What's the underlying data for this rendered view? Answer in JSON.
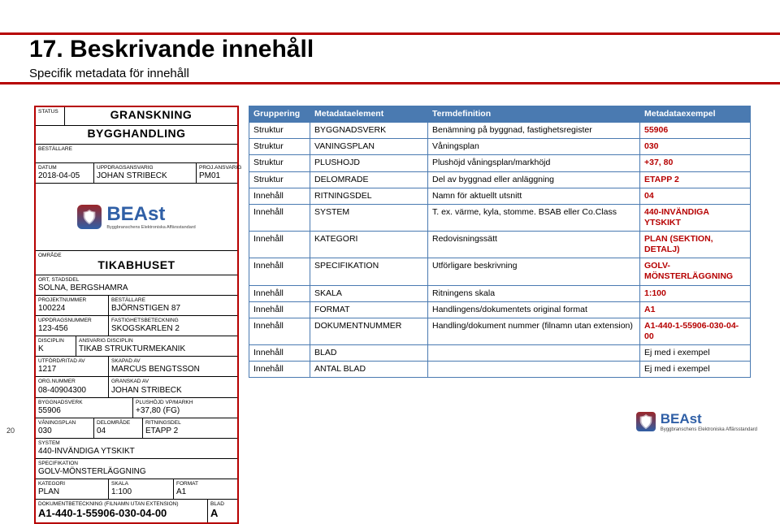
{
  "title": "17. Beskrivande innehåll",
  "subtitle": "Specifik metadata för innehåll",
  "pagenum": "20",
  "logo": {
    "brand": "BEAst",
    "tagline": "Byggbranschens Elektroniska Affärsstandard"
  },
  "form": {
    "r1": {
      "status_lbl": "STATUS",
      "status_val": "",
      "gransk": "GRANSKNING",
      "bygghand": "BYGGHANDLING"
    },
    "r2": {
      "best_lbl": "BESTÄLLARE",
      "best_val": ""
    },
    "r3": {
      "datum_lbl": "DATUM",
      "datum_val": "2018-04-05",
      "upp_lbl": "UPPDRAGSANSVARIG",
      "upp_val": "JOHAN STRIBECK",
      "proj_lbl": "PROJ.ANSVARIG",
      "proj_val": "PM01"
    },
    "r4": {
      "omr_lbl": "OMRÅDE",
      "omr_val": "TIKABHUSET"
    },
    "r5": {
      "ort_lbl": "ORT, STADSDEL",
      "ort_val": "SOLNA, BERGSHAMRA"
    },
    "r6": {
      "proj_lbl": "PROJEKTNUMMER",
      "proj_val": "100224",
      "best_lbl": "BESTÄLLARE",
      "best_val": "BJÖRNSTIGEN 87"
    },
    "r7": {
      "uppd_lbl": "UPPDRAGSNUMMER",
      "uppd_val": "123-456",
      "fast_lbl": "FASTIGHETSBETECKNING",
      "fast_val": "SKOGSKARLEN 2"
    },
    "r8": {
      "disc_lbl": "DISCIPLIN",
      "disc_val": "K",
      "ans_lbl": "ANSVARIG DISCIPLIN",
      "ans_val": "TIKAB STRUKTURMEKANIK"
    },
    "r9": {
      "uf_lbl": "UTFÖRD/RITAD AV",
      "uf_val": "1217",
      "skap_lbl": "SKAPAD AV",
      "skap_val": "MARCUS BENGTSSON"
    },
    "r10": {
      "orgn_lbl": "ORG.NUMMER",
      "orgn_val": "08-40904300",
      "gr_lbl": "GRANSKAD AV",
      "gr_val": "JOHAN STRIBECK"
    },
    "r11": {
      "bv_lbl": "BYGGNADSVERK",
      "bv_val": "55906",
      "plus_lbl": "PLUSHÖJD VP/MARKH",
      "plus_val": "+37,80 (FG)"
    },
    "r12": {
      "vp_lbl": "VÅNINGSPLAN",
      "vp_val": "030",
      "do_lbl": "DELOMRÅDE",
      "do_val": "04",
      "rit_lbl": "RITNINGSDEL",
      "rit_val": "ETAPP 2"
    },
    "r13": {
      "sys_lbl": "SYSTEM",
      "sys_val": "440-INVÄNDIGA YTSKIKT"
    },
    "r14": {
      "spec_lbl": "SPECIFIKATION",
      "spec_val": "GOLV-MÖNSTERLÄGGNING"
    },
    "r15": {
      "kat_lbl": "KATEGORI",
      "kat_val": "PLAN",
      "sk_lbl": "SKALA",
      "sk_val": "1:100",
      "fmt_lbl": "FORMAT",
      "fmt_val": "A1"
    },
    "r16": {
      "dok_lbl": "DOKUMENTBETECKNING (FILNAMN UTAN EXTENSION)",
      "dok_val": "A1-440-1-55906-030-04-00",
      "blad_lbl": "BLAD",
      "blad_val": "A"
    }
  },
  "table": {
    "headers": {
      "c1": "Gruppering",
      "c2": "Metadataelement",
      "c3": "Termdefinition",
      "c4": "Metadataexempel"
    },
    "rows": [
      {
        "c1": "Struktur",
        "c2": "BYGGNADSVERK",
        "c3": "Benämning på byggnad, fastighetsregister",
        "c4": "55906"
      },
      {
        "c1": "Struktur",
        "c2": "VANINGSPLAN",
        "c3": "Våningsplan",
        "c4": "030"
      },
      {
        "c1": "Struktur",
        "c2": "PLUSHOJD",
        "c3": "Plushöjd våningsplan/markhöjd",
        "c4": "+37, 80"
      },
      {
        "c1": "Struktur",
        "c2": "DELOMRADE",
        "c3": "Del av byggnad eller anläggning",
        "c4": "ETAPP 2"
      },
      {
        "c1": "Innehåll",
        "c2": "RITNINGSDEL",
        "c3": "Namn för aktuellt utsnitt",
        "c4": "04"
      },
      {
        "c1": "Innehåll",
        "c2": "SYSTEM",
        "c3": "T. ex. värme, kyla, stomme. BSAB eller Co.Class",
        "c4": "440-INVÄNDIGA YTSKIKT"
      },
      {
        "c1": "Innehåll",
        "c2": "KATEGORI",
        "c3": "Redovisningssätt",
        "c4": "PLAN (SEKTION, DETALJ)"
      },
      {
        "c1": "Innehåll",
        "c2": "SPECIFIKATION",
        "c3": "Utförligare beskrivning",
        "c4": "GOLV-MÖNSTERLÄGGNING"
      },
      {
        "c1": "Innehåll",
        "c2": "SKALA",
        "c3": "Ritningens skala",
        "c4": "1:100"
      },
      {
        "c1": "Innehåll",
        "c2": "FORMAT",
        "c3": "Handlingens/dokumentets original format",
        "c4": "A1"
      },
      {
        "c1": "Innehåll",
        "c2": "DOKUMENTNUMMER",
        "c3": "Handling/dokument nummer (filnamn utan extension)",
        "c4": "A1-440-1-55906-030-04-00"
      },
      {
        "c1": "Innehåll",
        "c2": "BLAD",
        "c3": "",
        "c4e": "Ej med i exempel"
      },
      {
        "c1": "Innehåll",
        "c2": "ANTAL BLAD",
        "c3": "",
        "c4e": "Ej med i exempel"
      }
    ]
  }
}
